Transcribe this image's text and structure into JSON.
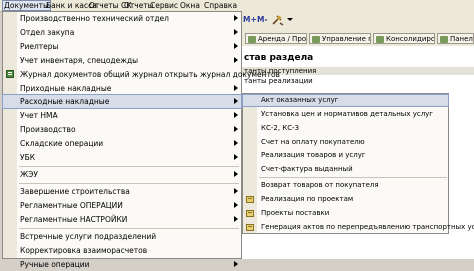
{
  "menubar": {
    "items": [
      "Документы",
      "Банк и касса",
      "Отчеты СК",
      "Отчеты",
      "Сервис",
      "Окна",
      "Справка"
    ]
  },
  "toolbar": {
    "mplus": "M+",
    "mminus": "M-"
  },
  "tabs": [
    "Аренда / Про...",
    "Управление п...",
    "Консолидиро...",
    "Панель"
  ],
  "content": {
    "title": "став раздела",
    "lines": [
      "танты поступления",
      "танты реализации"
    ]
  },
  "menu": {
    "items": [
      {
        "label": "Производственно технический отдел",
        "arrow": true
      },
      {
        "label": "Отдел закупа",
        "arrow": true
      },
      {
        "label": "Риелтеры",
        "arrow": true
      },
      {
        "label": "Учет инвентаря, спецодежды",
        "arrow": true
      },
      {
        "label": "Журнал документов общий журнал открыть журнал документов",
        "arrow": false,
        "icon": "journal-icon"
      },
      {
        "label": "Приходные накладные",
        "arrow": true
      },
      {
        "label": "Расходные накладные",
        "arrow": true,
        "selected": true
      },
      {
        "label": "Учет НМА",
        "arrow": true
      },
      {
        "label": "Производство",
        "arrow": true
      },
      {
        "label": "Складские операции",
        "arrow": true
      },
      {
        "label": "УБК",
        "arrow": true
      },
      {
        "label": "ЖЭУ",
        "arrow": true
      },
      {
        "label": "Завершение строительства",
        "arrow": true
      },
      {
        "label": "Регламентные ОПЕРАЦИИ",
        "arrow": true
      },
      {
        "label": "Регламентные НАСТРОЙКИ",
        "arrow": true
      },
      {
        "label": "Встречные услуги подразделений",
        "arrow": false
      },
      {
        "label": "Корректировка взаиморасчетов",
        "arrow": false
      },
      {
        "label": "Ручные операции",
        "arrow": true
      }
    ]
  },
  "submenu": {
    "items": [
      {
        "label": "Акт оказанных услуг",
        "selected": true
      },
      {
        "label": "Установка цен и нормативов детальных услуг"
      },
      {
        "label": "КС-2, КС-3"
      },
      {
        "label": "Счет на оплату покупателю"
      },
      {
        "label": "Реализация товаров и услуг"
      },
      {
        "label": "Счет-фактура выданный"
      },
      {
        "label": "Возврат товаров от покупателя"
      },
      {
        "label": "Реализация по проектам",
        "icon": true
      },
      {
        "label": "Проекты поставки",
        "icon": true
      },
      {
        "label": "Генерация актов по перепредъявлению транспортных услуг",
        "icon": true
      }
    ]
  },
  "colors": {
    "highlight": "#d6dce8",
    "menu_bg": "#fbfaf6",
    "chrome": "#ece9d8"
  }
}
